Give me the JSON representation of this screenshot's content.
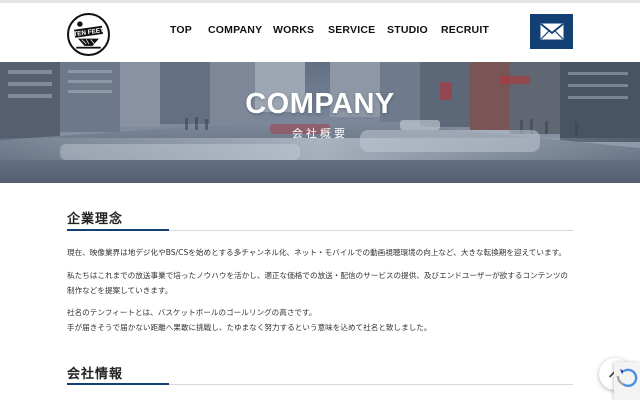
{
  "header": {
    "logo_icon": "tenfeet-logo",
    "nav": [
      "TOP",
      "COMPANY",
      "WORKS",
      "SERVICE",
      "STUDIO",
      "RECRUIT"
    ],
    "mail_icon": "envelope-icon",
    "accent_color": "#123f74"
  },
  "hero": {
    "title": "COMPANY",
    "subtitle": "会社概要"
  },
  "philosophy": {
    "heading": "企業理念",
    "paragraphs": [
      [
        "現在、映像業界は地デジ化やBS/CSを始めとする多チャンネル化、ネット・モバイルでの動画視聴環境の向上など、大きな転換期を迎えています。"
      ],
      [
        "私たちはこれまでの放送事業で培ったノウハウを活かし、適正な価格での放送・配信のサービスの提供、及びエンドユーザーが欲するコンテンツの",
        "制作などを提案していきます。"
      ],
      [
        "社名のテンフィートとは、バスケットボールのゴールリングの高さです。",
        "手が届きそうで届かない距離へ果敢に挑戦し、たゆまなく努力するという意味を込めて社名と致しました。"
      ]
    ]
  },
  "company_info": {
    "heading": "会社情報"
  },
  "scroll_top_icon": "chevron-up-icon",
  "recaptcha_icon": "recaptcha-icon"
}
